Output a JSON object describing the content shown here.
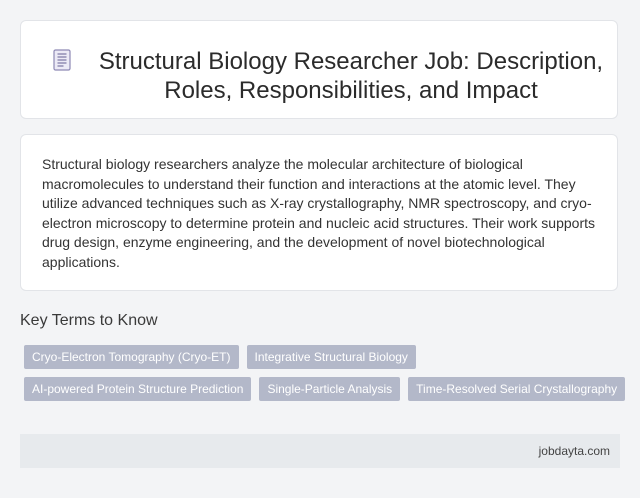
{
  "header": {
    "icon": "document-icon",
    "title": "Structural Biology Researcher Job: Description, Roles, Responsibilities, and Impact"
  },
  "description": {
    "text": "Structural biology researchers analyze the molecular architecture of biological macromolecules to understand their function and interactions at the atomic level. They utilize advanced techniques such as X-ray crystallography, NMR spectroscopy, and cryo-electron microscopy to determine protein and nucleic acid structures. Their work supports drug design, enzyme engineering, and the development of novel biotechnological applications."
  },
  "terms": {
    "heading": "Key Terms to Know",
    "rows": [
      [
        "Cryo-Electron Tomography (Cryo-ET)",
        "Integrative Structural Biology"
      ],
      [
        "AI-powered Protein Structure Prediction",
        "Single-Particle Analysis",
        "Time-Resolved Serial Crystallography"
      ]
    ]
  },
  "footer": {
    "site": "jobdayta.com"
  },
  "colors": {
    "tag_bg": "#b3b8c9",
    "footer_bg": "#e7eaed",
    "page_bg": "#f3f4f6"
  }
}
